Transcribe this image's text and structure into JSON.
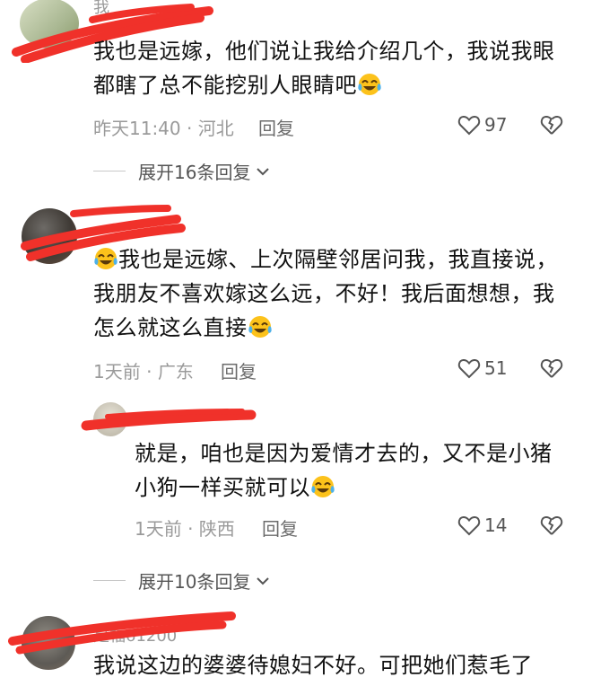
{
  "comments": [
    {
      "username": "我",
      "text": "我也是远嫁，他们说让我给介绍几个，我说我眼都瞎了总不能挖别人眼睛吧",
      "time": "昨天11:40",
      "location": "河北",
      "reply_label": "回复",
      "likes": "97",
      "expand_label": "展开16条回复"
    },
    {
      "username": "",
      "text": "我也是远嫁、上次隔壁邻居问我，我直接说，我朋友不喜欢嫁这么远，不好！我后面想想，我怎么就这么直接",
      "time": "1天前",
      "location": "广东",
      "reply_label": "回复",
      "likes": "51",
      "replies": [
        {
          "username": "",
          "text": "就是，咱也是因为爱情才去的，又不是小猪小狗一样买就可以",
          "time": "1天前",
          "location": "陕西",
          "reply_label": "回复",
          "likes": "14"
        }
      ],
      "expand_label": "展开10条回复"
    },
    {
      "username": "是福61200",
      "text": "我说这边的婆婆待媳妇不好。可把她们惹毛了"
    }
  ],
  "colors": {
    "redaction": "#f0312a",
    "muted": "#9a9a9a",
    "text": "#111111"
  },
  "icons": {
    "like": "heart-outline-icon",
    "dislike": "broken-heart-icon",
    "expand": "chevron-down-icon",
    "emoji": "laughing-tears-emoji-icon"
  }
}
